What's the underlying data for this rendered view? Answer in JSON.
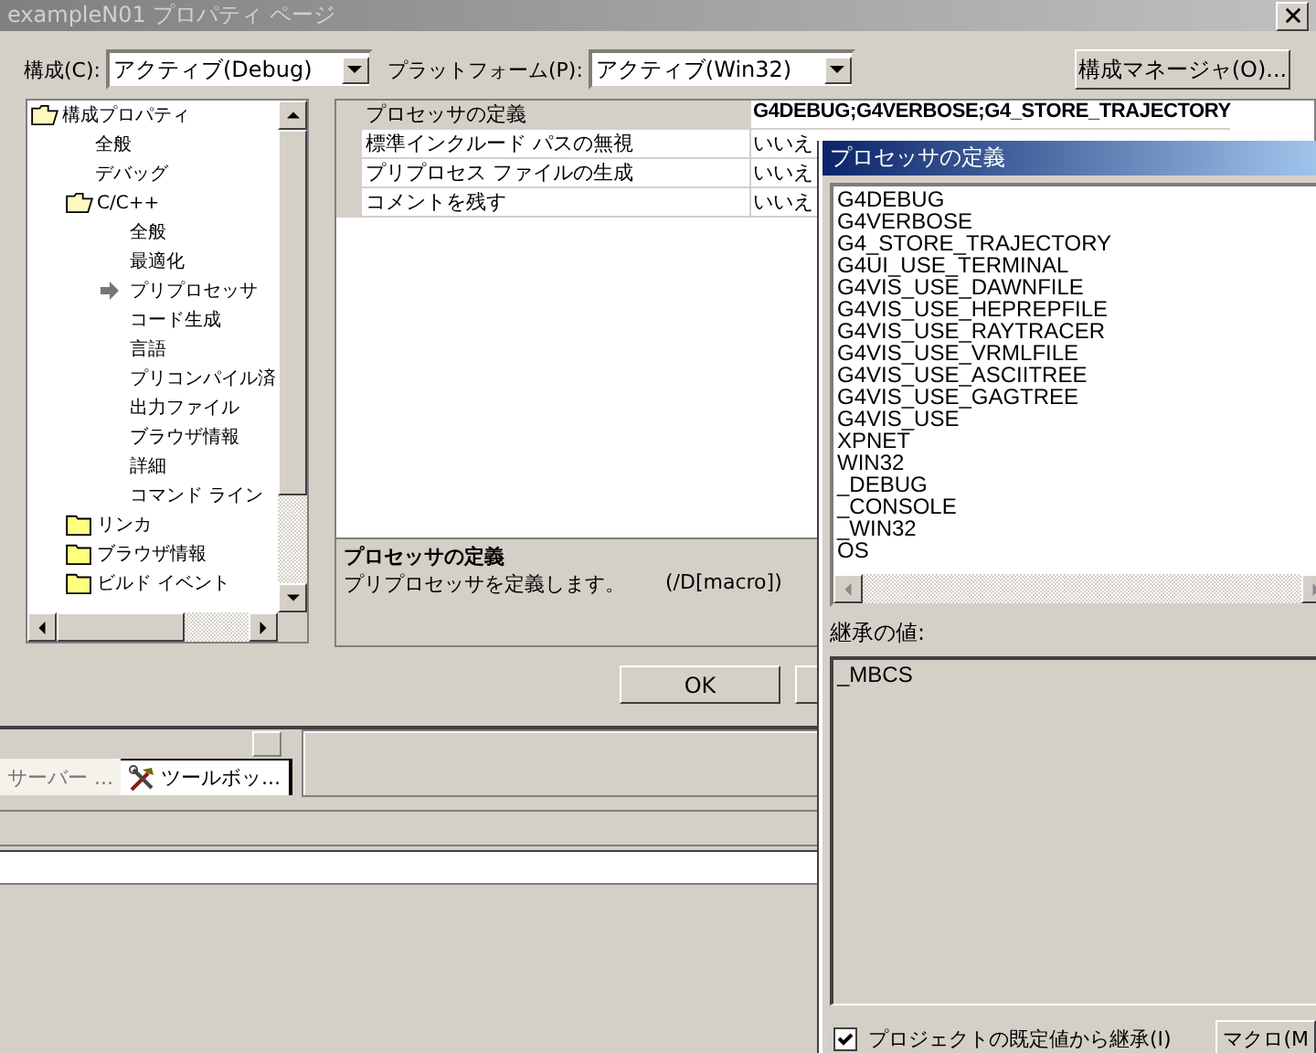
{
  "ide": {
    "tabs": [
      {
        "label": "サーバー ...",
        "selected": false
      },
      {
        "label": "ツールボッ...",
        "selected": true
      }
    ]
  },
  "main_dialog": {
    "title": "exampleN01 プロパティ ページ",
    "config_label": "構成(C):",
    "config_value": "アクティブ(Debug)",
    "platform_label": "プラットフォーム(P):",
    "platform_value": "アクティブ(Win32)",
    "manager_button": "構成マネージャ(O)...",
    "tree": [
      {
        "label": "構成プロパティ",
        "kind": "folder",
        "expanded": true,
        "children": [
          {
            "label": "全般",
            "kind": "page",
            "selected": false
          },
          {
            "label": "デバッグ",
            "kind": "page",
            "selected": false
          },
          {
            "label": "C/C++",
            "kind": "folder",
            "expanded": true,
            "children": [
              {
                "label": "全般",
                "kind": "page",
                "selected": false
              },
              {
                "label": "最適化",
                "kind": "page",
                "selected": false
              },
              {
                "label": "プリプロセッサ",
                "kind": "page",
                "selected": true
              },
              {
                "label": "コード生成",
                "kind": "page",
                "selected": false
              },
              {
                "label": "言語",
                "kind": "page",
                "selected": false
              },
              {
                "label": "プリコンパイル済",
                "kind": "page",
                "selected": false
              },
              {
                "label": "出力ファイル",
                "kind": "page",
                "selected": false
              },
              {
                "label": "ブラウザ情報",
                "kind": "page",
                "selected": false
              },
              {
                "label": "詳細",
                "kind": "page",
                "selected": false
              },
              {
                "label": "コマンド ライン",
                "kind": "page",
                "selected": false
              }
            ]
          },
          {
            "label": "リンカ",
            "kind": "folder",
            "expanded": false
          },
          {
            "label": "ブラウザ情報",
            "kind": "folder",
            "expanded": false
          },
          {
            "label": "ビルド イベント",
            "kind": "folder",
            "expanded": false
          }
        ]
      }
    ],
    "properties": [
      {
        "name": "プロセッサの定義",
        "value": "G4DEBUG;G4VERBOSE;G4_STORE_TRAJECTORY",
        "selected": true
      },
      {
        "name": "標準インクルード パスの無視",
        "value": "いいえ",
        "selected": false
      },
      {
        "name": "プリプロセス ファイルの生成",
        "value": "いいえ",
        "selected": false
      },
      {
        "name": "コメントを残す",
        "value": "いいえ",
        "selected": false
      }
    ],
    "description": {
      "title": "プロセッサの定義",
      "text": "プリプロセッサを定義します。",
      "switch": "(/D[macro])"
    },
    "ok_button": "OK"
  },
  "definitions_dialog": {
    "title": "プロセッサの定義",
    "definitions": [
      "G4DEBUG",
      "G4VERBOSE",
      "G4_STORE_TRAJECTORY",
      "G4UI_USE_TERMINAL",
      "G4VIS_USE_DAWNFILE",
      "G4VIS_USE_HEPREPFILE",
      "G4VIS_USE_RAYTRACER",
      "G4VIS_USE_VRMLFILE",
      "G4VIS_USE_ASCIITREE",
      "G4VIS_USE_GAGTREE",
      "G4VIS_USE",
      "XPNET",
      "WIN32",
      "_DEBUG",
      "_CONSOLE",
      "_WIN32",
      "OS"
    ],
    "inherited_label": "継承の値:",
    "inherited_values": [
      "_MBCS"
    ],
    "inherit_checkbox": {
      "label": "プロジェクトの既定値から継承(I)",
      "checked": true
    },
    "macro_button": "マクロ(M"
  }
}
